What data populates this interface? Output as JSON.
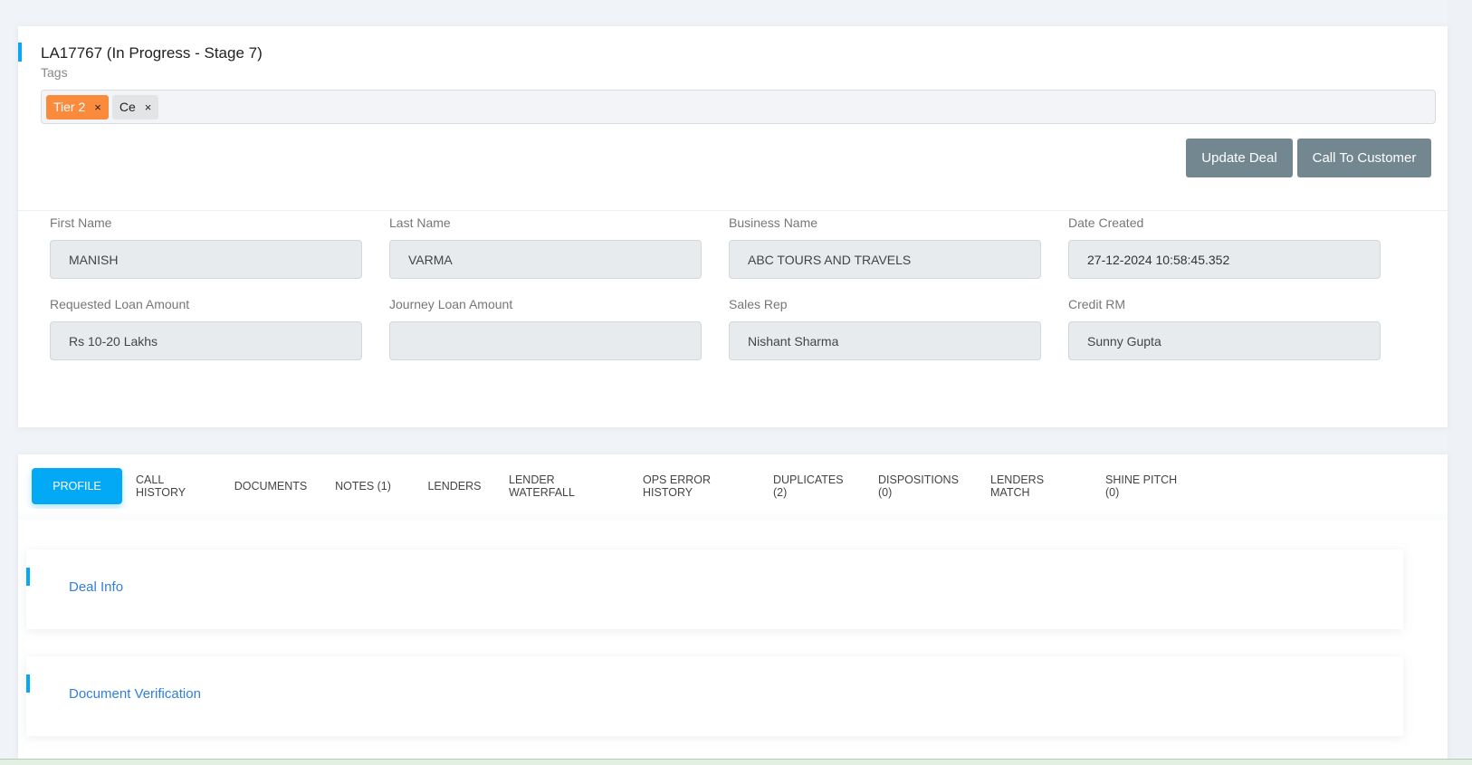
{
  "deal": {
    "title": "LA17767 (In Progress - Stage 7)",
    "tags_label": "Tags",
    "tags": [
      {
        "label": "Tier 2",
        "color": "#fa8b3c",
        "remove_icon": "close-icon"
      },
      {
        "label": "Ce",
        "color": "#e2e4e6",
        "remove_icon": "close-icon"
      }
    ],
    "buttons": {
      "update": "Update Deal",
      "call": "Call To Customer"
    }
  },
  "form": {
    "fields": [
      {
        "label": "First Name",
        "value": "MANISH"
      },
      {
        "label": "Last Name",
        "value": "VARMA"
      },
      {
        "label": "Business Name",
        "value": "ABC TOURS AND TRAVELS"
      },
      {
        "label": "Date Created",
        "value": "27-12-2024 10:58:45.352"
      },
      {
        "label": "Requested Loan Amount",
        "value": "Rs 10-20 Lakhs"
      },
      {
        "label": "Journey Loan Amount",
        "value": ""
      },
      {
        "label": "Sales Rep",
        "value": "Nishant Sharma"
      },
      {
        "label": "Credit RM",
        "value": "Sunny Gupta"
      }
    ]
  },
  "tabs": [
    {
      "label": "PROFILE",
      "active": true
    },
    {
      "label": "CALL HISTORY"
    },
    {
      "label": "DOCUMENTS"
    },
    {
      "label": "NOTES (1)"
    },
    {
      "label": "LENDERS"
    },
    {
      "label": "LENDER WATERFALL"
    },
    {
      "label": "OPS ERROR HISTORY"
    },
    {
      "label": "DUPLICATES (2)"
    },
    {
      "label": "DISPOSITIONS (0)"
    },
    {
      "label": "LENDERS MATCH"
    },
    {
      "label": "SHINE PITCH (0)"
    }
  ],
  "sections": [
    {
      "title": "Deal Info"
    },
    {
      "title": "Document Verification"
    }
  ],
  "colors": {
    "accent": "#03a9f4",
    "button": "#728790",
    "tag_orange": "#fa8b3c",
    "section_title": "#2f7fe0"
  }
}
